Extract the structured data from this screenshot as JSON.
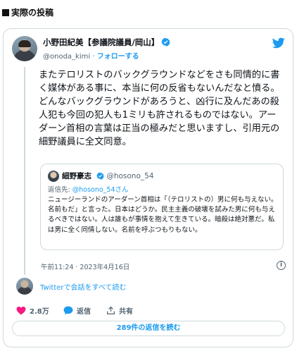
{
  "section": {
    "heading": "実際の投稿"
  },
  "tweet": {
    "author_name": "小野田紀美【参議院議員/岡山】",
    "author_handle": "@onoda_kimi",
    "separator": " · ",
    "follow_label": "フォローする",
    "body": "またテロリストのバックグラウンドなどをさも同情的に書く媒体がある事に、本当に何の反省もないんだなと憤る。どんなバックグラウンドがあろうと、凶行に及んだあの殺人犯も今回の犯人も1ミリも許されるものではない。アーダーン首相の言葉は正当の極みだと思いますし、引用元の細野議員に全文同意。",
    "timestamp": "午前11:24 · 2023年4月16日",
    "conversation_link": "Twitterで会話をすべて読む",
    "like_count": "2.8万",
    "reply_label": "返信",
    "share_label": "共有",
    "replies_button": "289件の返信を読む"
  },
  "quoted": {
    "author_name": "細野豪志",
    "author_handle": "@hosono_54",
    "reply_to_prefix": "返信先: ",
    "reply_to_handle": "@hosono_54さん",
    "body": "ニュージーランドのアーダーン首相は「（テロリストの）男に何も与えない。名前もだ」と言った。日本はどうか。民主主義の破壊を試みた男に何も与えるべきではない。人は誰もが事情を抱えて生きている。暗殺は絶対悪だ。私は男に全く同情しない。名前を呼ぶつもりもない。"
  },
  "icons": {
    "brand": "twitter-bird-icon",
    "verified": "verified-badge-icon",
    "like": "heart-icon",
    "reply": "speech-bubble-icon",
    "share": "share-upload-icon",
    "info": "info-icon"
  },
  "colors": {
    "accent": "#1d9bf0",
    "like": "#f91880",
    "text": "#0f1419",
    "muted": "#536471",
    "border": "#cfd9de"
  }
}
